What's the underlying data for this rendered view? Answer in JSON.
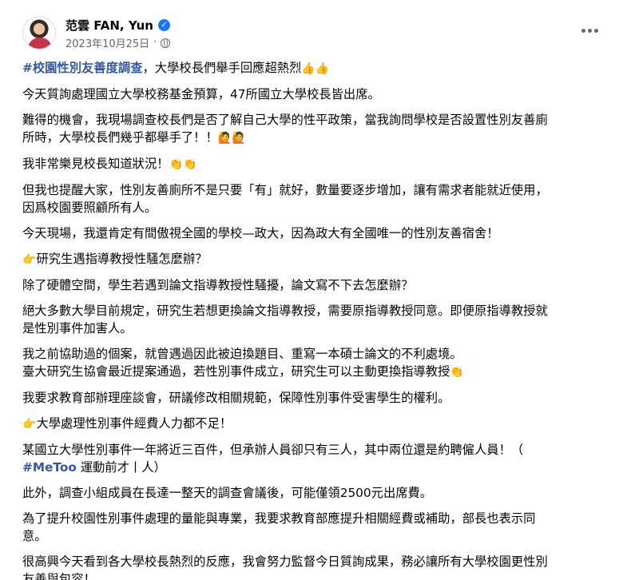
{
  "post": {
    "author": "范雲 FAN, Yun",
    "date": "2023年10月25日",
    "separator": "·",
    "verified_mark": "✓",
    "icons": {
      "verified": "verified-badge-icon",
      "audience": "globe-icon",
      "menu": "more-horizontal-icon"
    },
    "accent_color": "#385898"
  },
  "content": {
    "p1": {
      "hashtag": "#校園性別友善度調查",
      "text": "，大學校長們舉手回應超熱烈",
      "emoji": "👍👍"
    },
    "p2": "今天質詢處理國立大學校務基金預算，47所國立大學校長皆出席。",
    "p3": {
      "line1": "難得的機會，我現場調查校長們是否了解自己大學的性平政策，當我詢問學校是否設置性別友善廁",
      "line2": "所時，大學校長們幾乎都舉手了！！",
      "emoji": "🙋🙋"
    },
    "p4": {
      "text": "我非常樂見校長知道狀況！",
      "emoji": "👏👏"
    },
    "p5": {
      "line1": "但我也提醒大家，性別友善廁所不是只要「有」就好，數量要逐步增加，讓有需求者能就近使用，",
      "line2": "因爲校園要照顧所有人。"
    },
    "p6": "今天現場，我還肯定有間傲視全國的學校—政大，因為政大有全國唯一的性別友善宿舍！",
    "p7": {
      "emoji": "👉",
      "text": "研究生遇指導教授性騷怎麼辦？"
    },
    "p8": "除了硬體空間，學生若遇到論文指導教授性騷擾，論文寫不下去怎麼辦？",
    "p9": {
      "line1": "絕大多數大學目前規定，研究生若想更換論文指導教授，需要原指導教授同意。即便原指導教授就",
      "line2": "是性別事件加害人。"
    },
    "p10": {
      "line1": "我之前協助過的個案，就曾遇過因此被迫換題目、重寫一本碩士論文的不利處境。",
      "line2": "臺大研究生協會最近提案通過，若性別事件成立，研究生可以主動更換指導教授",
      "emoji": "👏"
    },
    "p11": "我要求教育部辦理座談會，研議修改相關規範，保障性別事件受害學生的權利。",
    "p12": {
      "emoji": "👉",
      "text": "大學處理性別事件經費人力都不足！"
    },
    "p13": {
      "line1": "某國立大學性別事件一年將近三百件，但承辦人員卻只有三人，其中兩位還是約聘僱人員！（",
      "hashtag": "#MeToo",
      "line2": " 運動前才丨人）"
    },
    "p14": "此外，調查小組成員在長達一整天的調查會議後，可能僅領2500元出席費。",
    "p15": {
      "line1": "為了提升校園性別事件處理的量能與專業，我要求教育部應提升相關經費或補助，部長也表示同",
      "line2": "意。"
    },
    "p16": {
      "line1": "很高興今天看到各大學校長熱烈的反應，我會努力監督今日質詢成果，務必讓所有大學校園更性別",
      "line2": "友善與包容！"
    }
  }
}
